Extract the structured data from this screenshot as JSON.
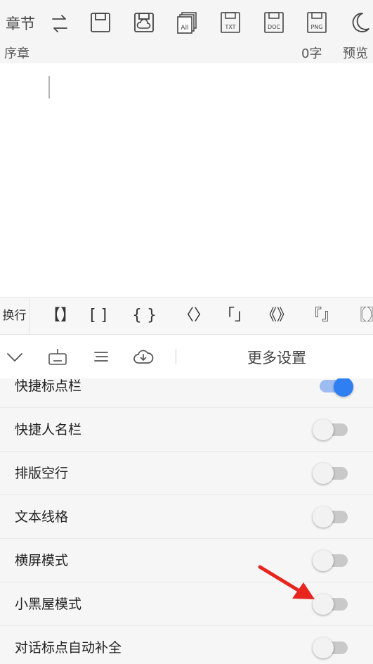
{
  "toolbar": {
    "chapter_label": "章节",
    "chapter_name": "序章",
    "word_count": "0字",
    "preview_label": "预览",
    "icons": [
      "swap-arrows-icon",
      "save-icon",
      "save-cloud-icon",
      "export-all-icon",
      "export-txt-icon",
      "export-doc-icon",
      "export-png-icon",
      "night-mode-icon"
    ],
    "export_labels": {
      "all": "All",
      "txt": "TXT",
      "doc": "DOC",
      "png": "PNG"
    }
  },
  "editor": {
    "content": ""
  },
  "bracket_bar": {
    "newline_label": "换行",
    "brackets": [
      "【】",
      "[ ]",
      "{ }",
      "〈〉",
      "「」",
      "《》",
      "『』",
      "〖〗"
    ]
  },
  "bar2": {
    "more_settings_label": "更多设置",
    "icons": [
      "chevron-down-icon",
      "keyboard-icon",
      "list-icon",
      "cloud-download-icon"
    ]
  },
  "settings": {
    "items": [
      {
        "label": "快捷标点栏",
        "enabled": true
      },
      {
        "label": "快捷人名栏",
        "enabled": false
      },
      {
        "label": "排版空行",
        "enabled": false
      },
      {
        "label": "文本线格",
        "enabled": false
      },
      {
        "label": "横屏模式",
        "enabled": false
      },
      {
        "label": "小黑屋模式",
        "enabled": false
      },
      {
        "label": "对话标点自动补全",
        "enabled": false
      }
    ]
  },
  "colors": {
    "accent": "#2f7ef2",
    "arrow": "#e8241e",
    "toggle_off": "#c9c9c9"
  }
}
